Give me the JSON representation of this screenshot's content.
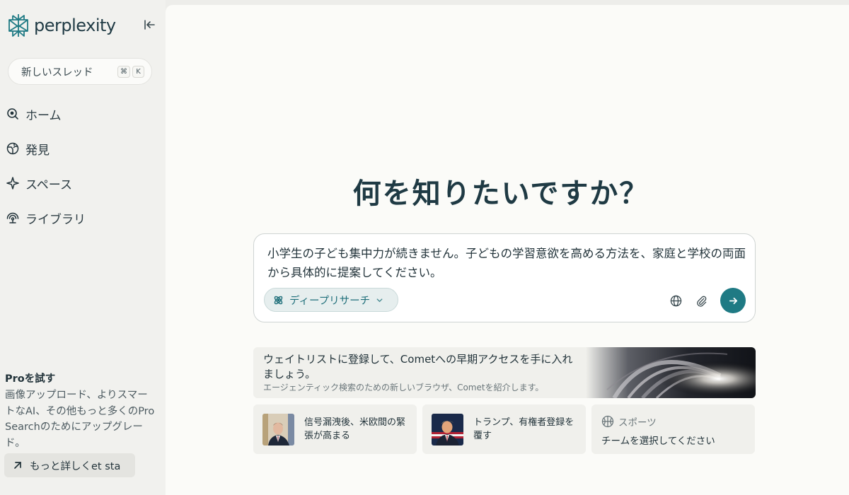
{
  "brand": {
    "name": "perplexity",
    "accent": "#1f7a84"
  },
  "sidebar": {
    "new_thread": {
      "label": "新しいスレッド",
      "shortcut": [
        "⌘",
        "K"
      ]
    },
    "nav": [
      {
        "label": "ホーム",
        "icon": "home-icon"
      },
      {
        "label": "発見",
        "icon": "discover-icon"
      },
      {
        "label": "スペース",
        "icon": "spaces-icon"
      },
      {
        "label": "ライブラリ",
        "icon": "library-icon"
      }
    ],
    "pro": {
      "title": "Proを試す",
      "description": "画像アップロード、よりスマートなAI、その他もっと多くのPro Searchのためにアップグレード。",
      "learn_more": "もっと詳しくet sta"
    }
  },
  "main": {
    "headline": "何を知りたいですか？",
    "search": {
      "query": "小学生の子ども集中力が続きません。子どもの学習意欲を高める方法を、家庭と学校の両面から具体的に提案してください。",
      "mode_label": "ディープリサーチ"
    },
    "banner": {
      "title": "ウェイトリストに登録して、Cometへの早期アクセスを手に入れましょう。",
      "subtitle": "エージェンティック検索のための新しいブラウザ、Cometを紹介します。"
    },
    "cards": [
      {
        "text": "信号漏洩後、米欧間の緊張が高まる"
      },
      {
        "text": "トランプ、有権者登録を覆す"
      }
    ],
    "sports": {
      "label": "スポーツ",
      "cta": "チームを選択してください"
    }
  }
}
